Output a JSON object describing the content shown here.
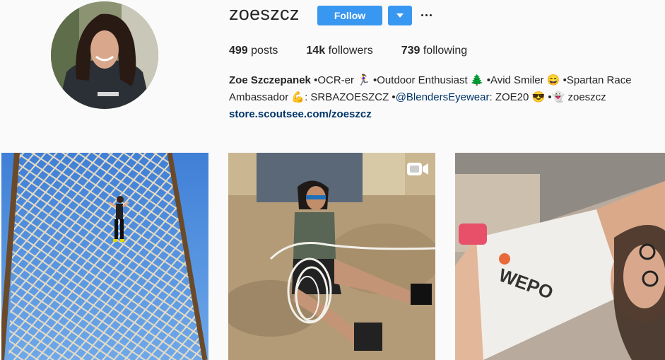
{
  "profile": {
    "username": "zoeszcz",
    "follow_label": "Follow",
    "stats": {
      "posts_count": "499",
      "posts_label": "posts",
      "followers_count": "14k",
      "followers_label": "followers",
      "following_count": "739",
      "following_label": "following"
    },
    "bio": {
      "full_name": "Zoe Szczepanek",
      "seg1": "•OCR-er",
      "seg2": "•Outdoor Enthusiast",
      "seg3": "•Avid Smiler",
      "seg4": "•Spartan Race",
      "seg5": "Ambassador",
      "seg6": ": SRBAZOESZCZ •",
      "mention": "@BlendersEyewear",
      "seg7": ": ZOE20",
      "seg8": "•",
      "seg9": "zoeszcz",
      "emoji_runner": "🏃‍♀️",
      "emoji_tree": "🌲",
      "emoji_smile": "😄",
      "emoji_muscle": "💪",
      "emoji_sunglasses": "😎",
      "emoji_ghost": "👻",
      "website": "store.scoutsee.com/zoeszcz"
    }
  },
  "icons": {
    "dropdown": "chevron-down-icon",
    "more": "more-horizontal-icon",
    "video": "video-camera-icon"
  },
  "colors": {
    "accent": "#3897f0",
    "link": "#003569",
    "background": "#fafafa",
    "text": "#262626"
  },
  "posts": [
    {
      "type": "photo",
      "alt": ""
    },
    {
      "type": "video",
      "alt": ""
    },
    {
      "type": "photo",
      "alt": ""
    }
  ]
}
